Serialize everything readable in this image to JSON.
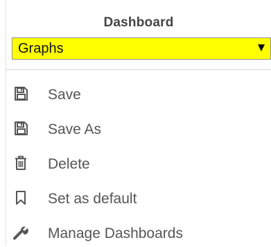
{
  "menu": {
    "section_title": "Dashboard",
    "dashboard_select": {
      "selected": "Graphs"
    },
    "items": [
      {
        "label": "Save",
        "icon": "floppy-disk-icon"
      },
      {
        "label": "Save As",
        "icon": "floppy-disk-icon"
      },
      {
        "label": "Delete",
        "icon": "trash-icon"
      },
      {
        "label": "Set as default",
        "icon": "bookmark-icon"
      },
      {
        "label": "Manage Dashboards",
        "icon": "wrench-icon"
      }
    ]
  },
  "colors": {
    "select_background": "#ffff00",
    "text": "#555555",
    "title": "#444444"
  }
}
